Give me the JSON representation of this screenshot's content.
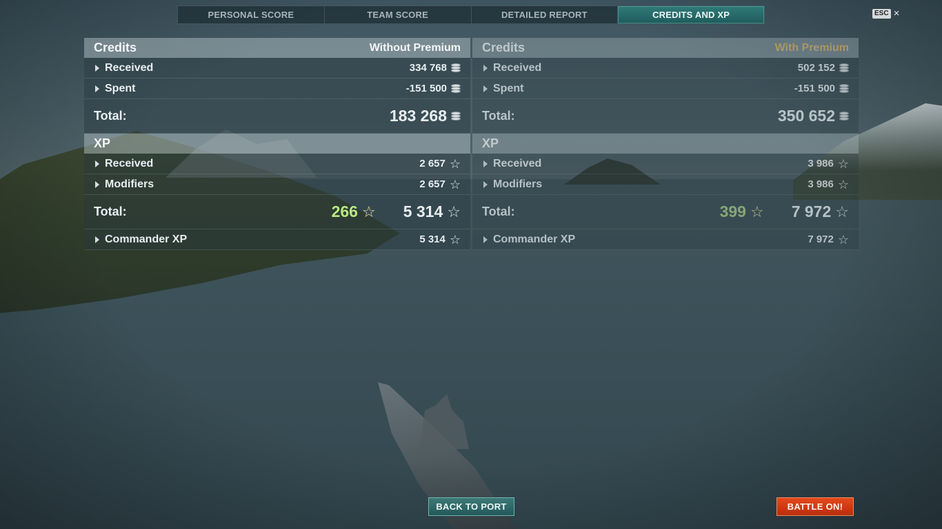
{
  "tabs": [
    {
      "label": "PERSONAL SCORE"
    },
    {
      "label": "TEAM SCORE"
    },
    {
      "label": "DETAILED REPORT"
    },
    {
      "label": "CREDITS AND XP",
      "active": true
    }
  ],
  "esc": {
    "key": "ESC",
    "close": "×"
  },
  "without_premium": {
    "credits_title": "Credits",
    "mode_label": "Without Premium",
    "credits_received_label": "Received",
    "credits_received": "334 768",
    "credits_spent_label": "Spent",
    "credits_spent": "-151 500",
    "credits_total_label": "Total:",
    "credits_total": "183 268",
    "xp_title": "XP",
    "xp_received_label": "Received",
    "xp_received": "2 657",
    "xp_modifiers_label": "Modifiers",
    "xp_modifiers": "2 657",
    "xp_total_label": "Total:",
    "xp_bonus": "266",
    "xp_total": "5 314",
    "commander_label": "Commander XP",
    "commander_xp": "5 314"
  },
  "with_premium": {
    "credits_title": "Credits",
    "mode_label": "With Premium",
    "credits_received_label": "Received",
    "credits_received": "502 152",
    "credits_spent_label": "Spent",
    "credits_spent": "-151 500",
    "credits_total_label": "Total:",
    "credits_total": "350 652",
    "xp_title": "XP",
    "xp_received_label": "Received",
    "xp_received": "3 986",
    "xp_modifiers_label": "Modifiers",
    "xp_modifiers": "3 986",
    "xp_total_label": "Total:",
    "xp_bonus": "399",
    "xp_total": "7 972",
    "commander_label": "Commander XP",
    "commander_xp": "7 972"
  },
  "buttons": {
    "back_to_port": "BACK TO PORT",
    "battle_on": "BATTLE ON!"
  },
  "icons": {
    "credits": "coin-stack-icon",
    "xp": "star-icon",
    "expand": "triangle-right-icon",
    "close": "close-icon"
  },
  "colors": {
    "active_tab": "#2f7a78",
    "battle_button": "#d63c14",
    "premium_label": "#d8b46a",
    "bonus_xp": "#b8e882"
  }
}
